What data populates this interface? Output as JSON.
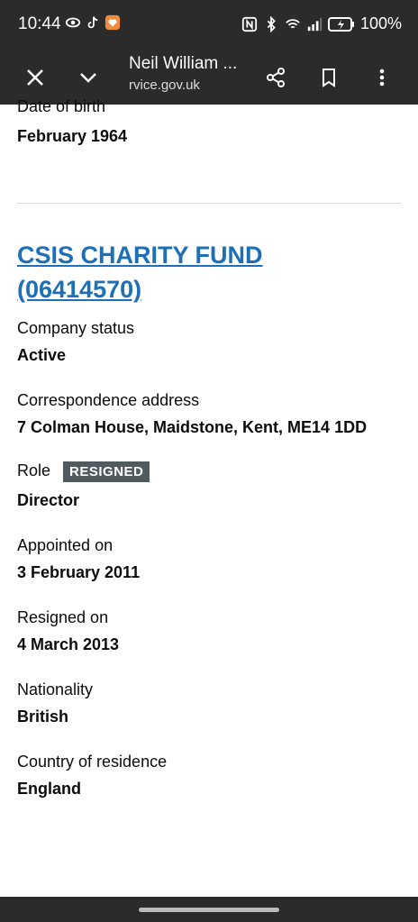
{
  "status_bar": {
    "time": "10:44",
    "battery": "100%"
  },
  "toolbar": {
    "title": "Neil William ...",
    "url": "rvice.gov.uk"
  },
  "previous_record": {
    "dob_label": "Date of birth",
    "dob_value": "February 1964"
  },
  "appointment": {
    "company_name": "CSIS CHARITY FUND (06414570)",
    "status_label": "Company status",
    "status_value": "Active",
    "address_label": "Correspondence address",
    "address_value": "7 Colman House, Maidstone, Kent, ME14 1DD",
    "role_label": "Role",
    "role_tag": "RESIGNED",
    "role_value": "Director",
    "appointed_label": "Appointed on",
    "appointed_value": "3 February 2011",
    "resigned_label": "Resigned on",
    "resigned_value": "4 March 2013",
    "nationality_label": "Nationality",
    "nationality_value": "British",
    "residence_label": "Country of residence",
    "residence_value": "England"
  },
  "colors": {
    "link": "#1d70b8",
    "tag_bg": "#505a5f",
    "chrome": "#2b2b2b"
  }
}
